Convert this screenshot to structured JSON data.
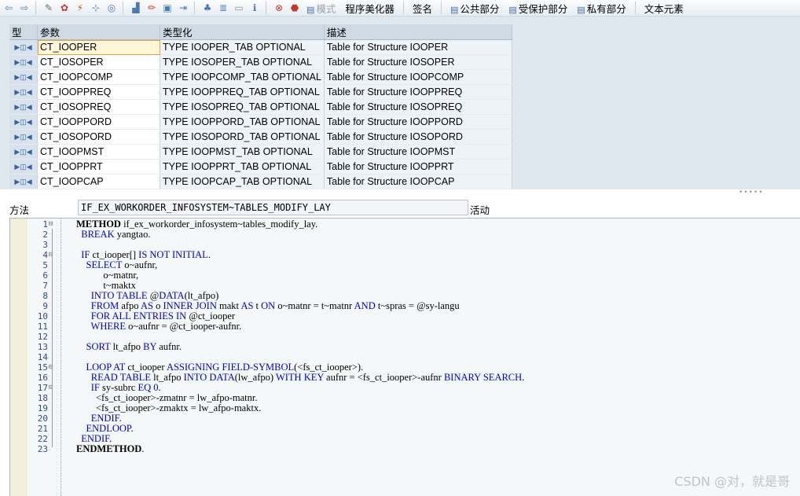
{
  "toolbar": {
    "mode_label": "模式",
    "pretty_printer_label": "程序美化器",
    "signature_label": "签名",
    "public_section_label": "公共部分",
    "protected_section_label": "受保护部分",
    "private_section_label": "私有部分",
    "text_elements_label": "文本元素",
    "icons": [
      "back-icon",
      "forward-icon",
      "other-object-icon",
      "check-icon",
      "activate-icon",
      "where-used-icon",
      "object-list-icon",
      "display-object-list-icon",
      "edit-icon",
      "pattern-icon",
      "insert-statement-icon",
      "hierarchy-icon",
      "navigation-icon",
      "display-icon",
      "info-icon",
      "test-icon",
      "abap-icon"
    ]
  },
  "param_table": {
    "headers": [
      "型",
      "参数",
      "类型化",
      "描述"
    ],
    "rows": [
      {
        "name": "CT_IOOPER",
        "typing": "TYPE IOOPER_TAB OPTIONAL",
        "desc": "Table for Structure IOOPER"
      },
      {
        "name": "CT_IOSOPER",
        "typing": "TYPE IOSOPER_TAB OPTIONAL",
        "desc": "Table for Structure IOSOPER"
      },
      {
        "name": "CT_IOOPCOMP",
        "typing": "TYPE IOOPCOMP_TAB OPTIONAL",
        "desc": "Table for Structure IOOPCOMP"
      },
      {
        "name": "CT_IOOPPREQ",
        "typing": "TYPE IOOPPREQ_TAB OPTIONAL",
        "desc": "Table for Structure IOOPPREQ"
      },
      {
        "name": "CT_IOSOPREQ",
        "typing": "TYPE IOSOPREQ_TAB OPTIONAL",
        "desc": "Table for Structure IOSOPREQ"
      },
      {
        "name": "CT_IOOPPORD",
        "typing": "TYPE IOOPPORD_TAB OPTIONAL",
        "desc": "Table for Structure IOOPPORD"
      },
      {
        "name": "CT_IOSOPORD",
        "typing": "TYPE IOSOPORD_TAB OPTIONAL",
        "desc": "Table for Structure IOSOPORD"
      },
      {
        "name": "CT_IOOPMST",
        "typing": "TYPE IOOPMST_TAB OPTIONAL",
        "desc": "Table for Structure IOOPMST"
      },
      {
        "name": "CT_IOOPPRT",
        "typing": "TYPE IOOPPRT_TAB OPTIONAL",
        "desc": "Table for Structure IOOPPRT"
      },
      {
        "name": "CT_IOOPCAP",
        "typing": "TYPE IOOPCAP_TAB OPTIONAL",
        "desc": "Table for Structure IOOPCAP"
      }
    ]
  },
  "method": {
    "label": "方法",
    "value": "IF_EX_WORKORDER_INFOSYSTEM~TABLES_MODIFY_LAY",
    "status": "活动"
  },
  "editor": {
    "lines": [
      "METHOD if_ex_workorder_infosystem~tables_modify_lay.",
      "  BREAK yangtao.",
      "",
      "  IF ct_iooper[] IS NOT INITIAL.",
      "    SELECT o~aufnr,",
      "           o~matnr,",
      "           t~maktx",
      "      INTO TABLE @DATA(lt_afpo)",
      "      FROM afpo AS o INNER JOIN makt AS t ON o~matnr = t~matnr AND t~spras = @sy-langu",
      "      FOR ALL ENTRIES IN @ct_iooper",
      "      WHERE o~aufnr = @ct_iooper-aufnr.",
      "",
      "    SORT lt_afpo BY aufnr.",
      "",
      "    LOOP AT ct_iooper ASSIGNING FIELD-SYMBOL(<fs_ct_iooper>).",
      "      READ TABLE lt_afpo INTO DATA(lw_afpo) WITH KEY aufnr = <fs_ct_iooper>-aufnr BINARY SEARCH.",
      "      IF sy-subrc EQ 0.",
      "        <fs_ct_iooper>-zmatnr = lw_afpo-matnr.",
      "        <fs_ct_iooper>-zmaktx = lw_afpo-maktx.",
      "      ENDIF.",
      "    ENDLOOP.",
      "  ENDIF.",
      "ENDMETHOD."
    ]
  },
  "watermark": "CSDN @对，就是哥"
}
